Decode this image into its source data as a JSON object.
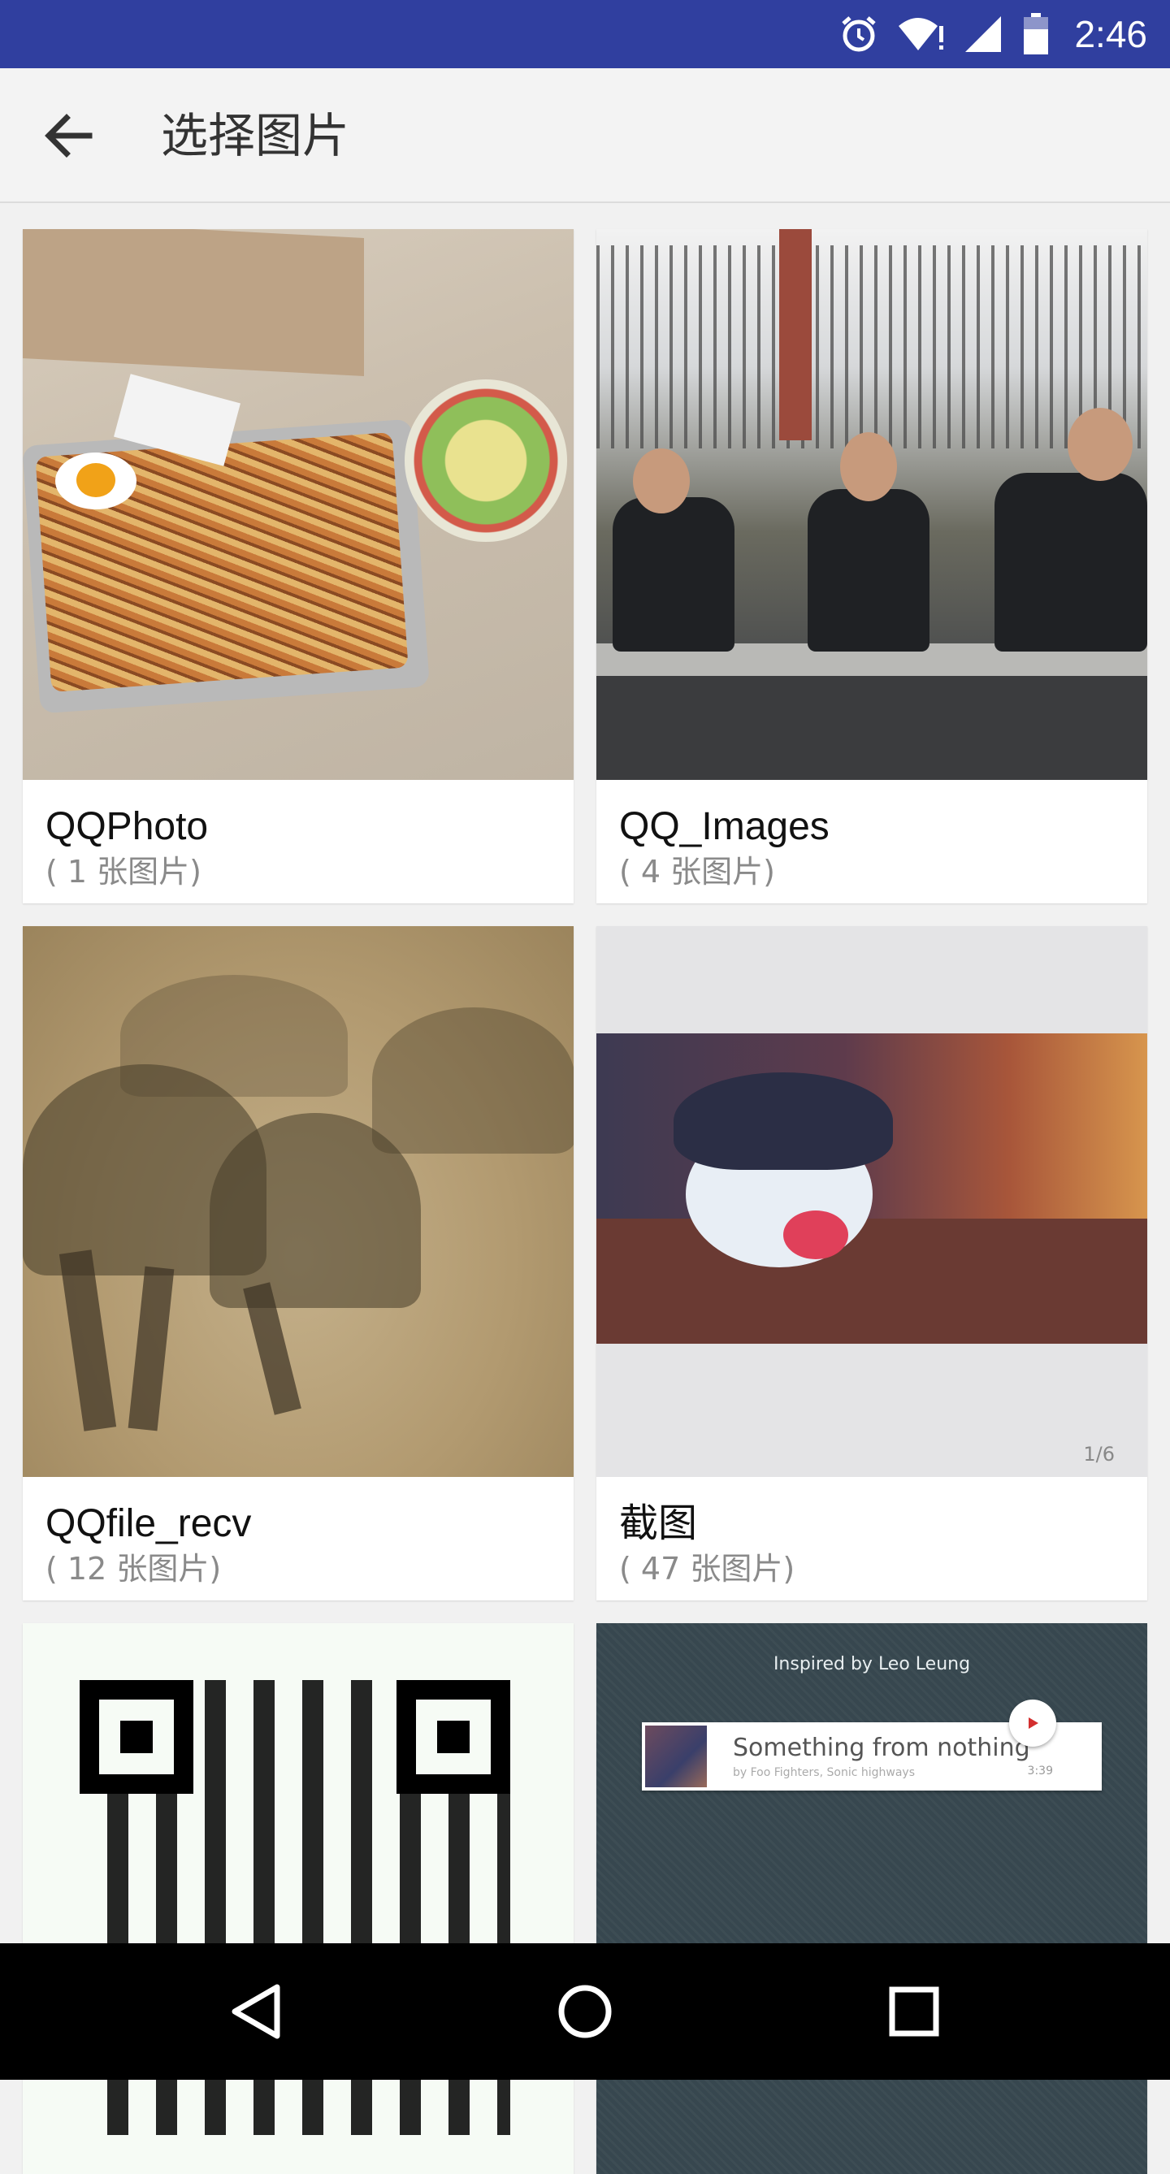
{
  "status_bar": {
    "time": "2:46",
    "background": "#303f9f",
    "icons": [
      "alarm-icon",
      "wifi-alert-icon",
      "signal-icon",
      "battery-icon"
    ]
  },
  "app_bar": {
    "title": "选择图片",
    "back_icon": "arrow-back-icon"
  },
  "albums": [
    {
      "name": "QQPhoto",
      "count": "( 1 张图片)"
    },
    {
      "name": "QQ_Images",
      "count": "( 4 张图片)"
    },
    {
      "name": "QQfile_recv",
      "count": "( 12 张图片)"
    },
    {
      "name": "截图",
      "count": "( 47 张图片)",
      "page_indicator": "1/6"
    },
    {
      "name": "",
      "count": ""
    },
    {
      "name": "",
      "count": "",
      "preview": {
        "inspired": "Inspired by Leo Leung",
        "song": "Something from nothing",
        "artist": "by Foo Fighters, Sonic highways",
        "duration": "3:39"
      }
    }
  ],
  "nav_bar": {
    "icons": [
      "back-triangle-icon",
      "home-circle-icon",
      "recents-square-icon"
    ]
  }
}
